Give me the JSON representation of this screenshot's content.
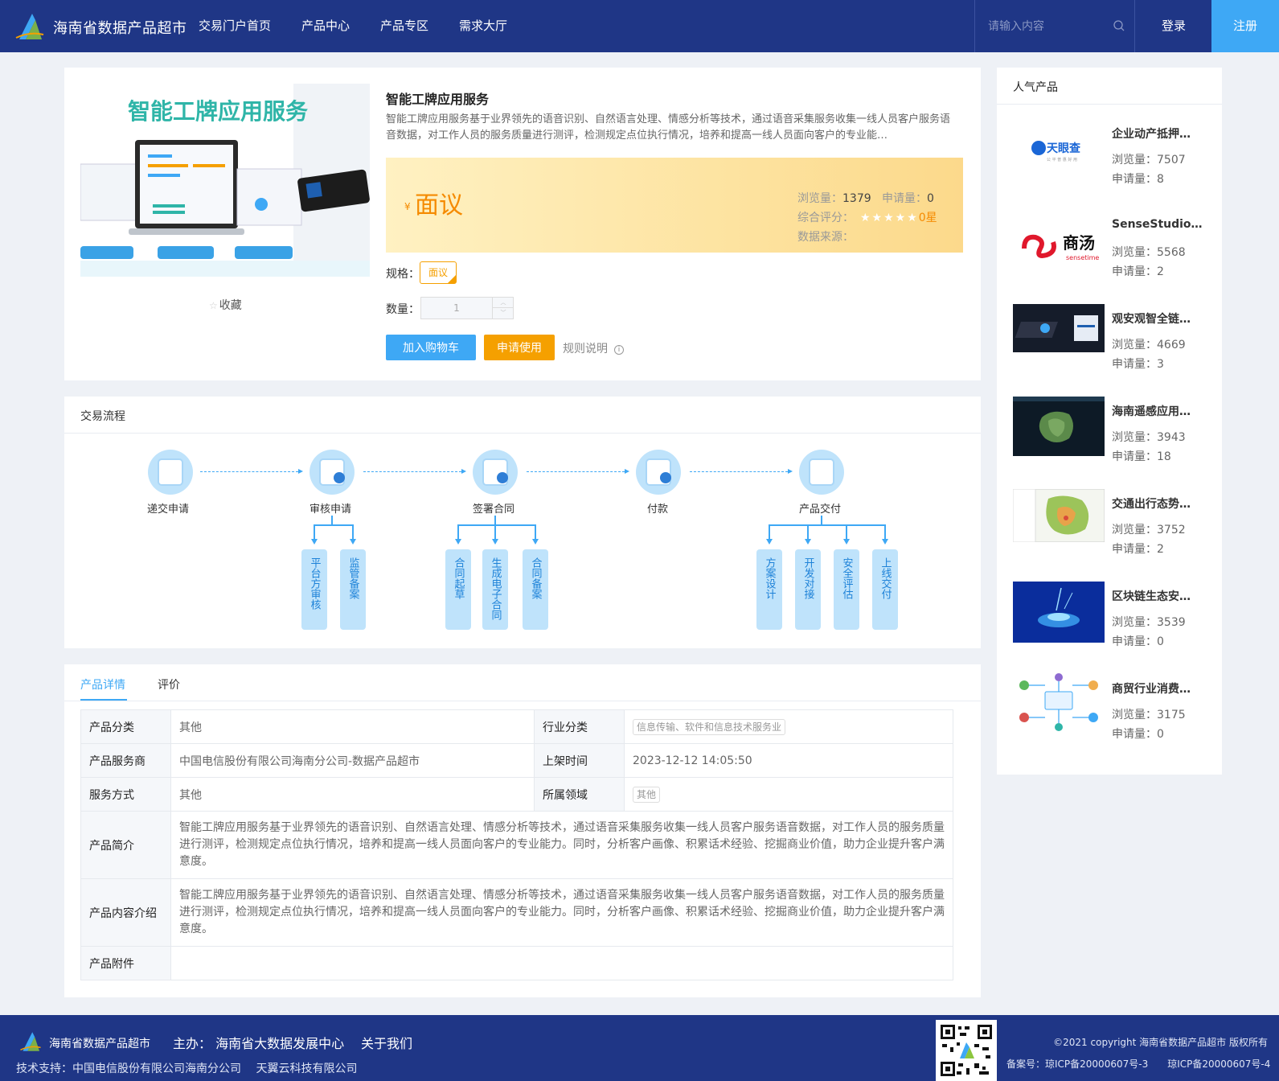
{
  "header": {
    "site_title": "海南省数据产品超市",
    "nav": [
      "交易门户首页",
      "产品中心",
      "产品专区",
      "需求大厅"
    ],
    "search_placeholder": "请输入内容",
    "login": "登录",
    "register": "注册",
    "colors": {
      "bar": "#1f3686",
      "register_bg": "#3ea8f5"
    }
  },
  "product": {
    "image_title": "智能工牌应用服务",
    "favorite": "收藏",
    "title": "智能工牌应用服务",
    "description": "智能工牌应用服务基于业界领先的语音识别、自然语言处理、情感分析等技术，通过语音采集服务收集一线人员客户服务语音数据，对工作人员的服务质量进行测评，检测规定点位执行情况，培养和提高一线人员面向客户的专业能…",
    "currency": "¥",
    "price": "面议",
    "views_label": "浏览量：",
    "views": "1379",
    "applies_label": "申请量：",
    "applies": "0",
    "rating_label": "综合评分：",
    "rating_text": "0星",
    "rating_value": 0,
    "source_label": "数据来源：",
    "spec_label": "规格：",
    "spec_value": "面议",
    "qty_label": "数量：",
    "qty_value": "1",
    "add_cart": "加入购物车",
    "apply": "申请使用",
    "rules": "规则说明"
  },
  "flow": {
    "title": "交易流程",
    "steps": [
      "递交申请",
      "审核申请",
      "签署合同",
      "付款",
      "产品交付"
    ],
    "sub_review": [
      "平台方审核",
      "监管备案"
    ],
    "sub_contract": [
      "合同起草",
      "生成电子合同",
      "合同备案"
    ],
    "sub_delivery": [
      "方案设计",
      "开发对接",
      "安全评估",
      "上线交付"
    ]
  },
  "detail": {
    "tabs": [
      "产品详情",
      "评价"
    ],
    "rows": {
      "category_label": "产品分类",
      "category": "其他",
      "industry_label": "行业分类",
      "industry": "信息传输、软件和信息技术服务业",
      "provider_label": "产品服务商",
      "provider": "中国电信股份有限公司海南分公司-数据产品超市",
      "listed_label": "上架时间",
      "listed": "2023-12-12 14:05:50",
      "service_label": "服务方式",
      "service": "其他",
      "domain_label": "所属领域",
      "domain": "其他",
      "intro_label": "产品简介",
      "intro": "智能工牌应用服务基于业界领先的语音识别、自然语言处理、情感分析等技术，通过语音采集服务收集一线人员客户服务语音数据，对工作人员的服务质量进行测评，检测规定点位执行情况，培养和提高一线人员面向客户的专业能力。同时，分析客户画像、积累话术经验、挖掘商业价值，助力企业提升客户满意度。",
      "content_label": "产品内容介绍",
      "content": "智能工牌应用服务基于业界领先的语音识别、自然语言处理、情感分析等技术，通过语音采集服务收集一线人员客户服务语音数据，对工作人员的服务质量进行测评，检测规定点位执行情况，培养和提高一线人员面向客户的专业能力。同时，分析客户画像、积累话术经验、挖掘商业价值，助力企业提升客户满意度。",
      "attach_label": "产品附件"
    }
  },
  "popular": {
    "title": "人气产品",
    "views_label": "浏览量：",
    "applies_label": "申请量：",
    "items": [
      {
        "name": "企业动产抵押…",
        "views": "7507",
        "applies": "8",
        "logo_text": "天眼查",
        "logo_sub": "公 平 普 惠 好 用"
      },
      {
        "name": "SenseStudio…",
        "views": "5568",
        "applies": "2",
        "logo_text": "商汤",
        "logo_sub": "sensetime"
      },
      {
        "name": "观安观智全链…",
        "views": "4669",
        "applies": "3"
      },
      {
        "name": "海南遥感应用…",
        "views": "3943",
        "applies": "18"
      },
      {
        "name": "交通出行态势…",
        "views": "3752",
        "applies": "2"
      },
      {
        "name": "区块链生态安…",
        "views": "3539",
        "applies": "0"
      },
      {
        "name": "商贸行业消费…",
        "views": "3175",
        "applies": "0"
      }
    ]
  },
  "footer": {
    "name": "海南省数据产品超市",
    "host": "主办： 海南省大数据发展中心",
    "about": "关于我们",
    "support": "技术支持：中国电信股份有限公司海南分公司　 天翼云科技有限公司",
    "copyright": "©2021 copyright 海南省数据产品超市 版权所有",
    "icp": "备案号：琼ICP备20000607号-3　　琼ICP备20000607号-4"
  }
}
